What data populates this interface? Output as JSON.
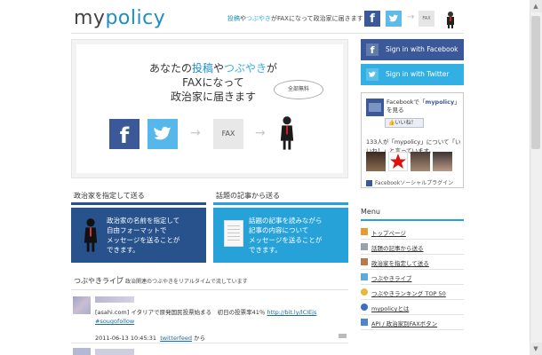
{
  "header": {
    "logo": "mypolicy",
    "tagline_parts": [
      "投稿",
      "や",
      "つぶやき",
      "がFAXになって政治家に届きます"
    ],
    "fax_label": "FAX"
  },
  "hero": {
    "title_line1_parts": [
      "あなたの",
      "投稿",
      "や",
      "つぶやき",
      "が"
    ],
    "title_line2": "FAXになって",
    "title_line3": "政治家に届きます",
    "bubble": "全部無料",
    "fax_label": "FAX"
  },
  "cards": [
    {
      "heading": "政治家を指定して送る",
      "lines": [
        "政治家の名前を指定して",
        "自由フォーマットで",
        "メッセージを送ることが",
        "できます。"
      ]
    },
    {
      "heading": "話題の記事から送る",
      "lines": [
        "話題の記事を読みながら",
        "記事の内容について",
        "メッセージを送ることが",
        "できます。"
      ]
    }
  ],
  "tweets": {
    "title": "つぶやきライブ",
    "subtitle": "政治関連のつぶやきをリアルタイムで流しています",
    "items": [
      {
        "text": "[asahi.com] イタリアで原発国民投票始まる　初日の投票率41％",
        "link": "http://bit.ly/lCIEjs",
        "hashtag": "#sougofollow",
        "timestamp": "2011-06-13 10:45:31",
        "via": "twitterfeed",
        "via_suffix": "から"
      }
    ]
  },
  "sidebar": {
    "signin_facebook": "Sign in with Facebook",
    "signin_twitter": "Sign in with Twitter",
    "fb_box": {
      "name_prefix": "Facebookで「",
      "name": "mypolicy",
      "name_suffix": "」を見る",
      "like_button": "いいね！",
      "count_text": "133人が「mypolicy」について「いいね！」と言っています。",
      "plugin_label": "Facebookソーシャルプラグイン"
    },
    "menu_title": "Menu",
    "menu_items": [
      {
        "label": "トップページ",
        "icon": "home-icon",
        "color": "#e59b32"
      },
      {
        "label": "話題の記事から送る",
        "icon": "news-icon",
        "color": "#9aa0b0"
      },
      {
        "label": "政治家を指定して送る",
        "icon": "politician-icon",
        "color": "#b77a4e"
      },
      {
        "label": "つぶやきライブ",
        "icon": "live-icon",
        "color": "#5fa9d9"
      },
      {
        "label": "つぶやきランキング TOP 50",
        "icon": "ranking-icon",
        "color": "#e5b93a"
      },
      {
        "label": "mypolicyとは",
        "icon": "help-icon",
        "color": "#3f6fb8"
      },
      {
        "label": "API / 政治家別FAXボタン",
        "icon": "api-icon",
        "color": "#4f86c6"
      }
    ]
  },
  "colors": {
    "facebook": "#3b5998",
    "twitter": "#33b0e3",
    "navy_card": "#27528c",
    "blue_card": "#27a2d9"
  }
}
